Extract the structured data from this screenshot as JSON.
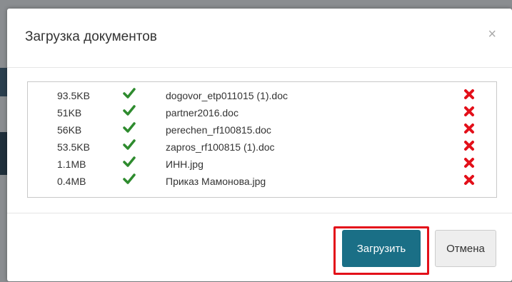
{
  "modal": {
    "title": "Загрузка документов",
    "close_glyph": "×"
  },
  "files": [
    {
      "size": "93.5KB",
      "name": "dogovor_etp011015 (1).doc"
    },
    {
      "size": "51KB",
      "name": "partner2016.doc"
    },
    {
      "size": "56KB",
      "name": "perechen_rf100815.doc"
    },
    {
      "size": "53.5KB",
      "name": "zapros_rf100815 (1).doc"
    },
    {
      "size": "1.1MB",
      "name": "ИНН.jpg"
    },
    {
      "size": "0.4MB",
      "name": "Приказ Мамонова.jpg"
    }
  ],
  "footer": {
    "upload_label": "Загрузить",
    "cancel_label": "Отмена"
  },
  "icons": {
    "status": "check-icon",
    "remove": "remove-icon",
    "close": "close-icon"
  },
  "colors": {
    "check": "#2e8b2e",
    "remove": "#e3101a",
    "primary_button": "#1a6f86",
    "highlight": "#e3101a"
  }
}
